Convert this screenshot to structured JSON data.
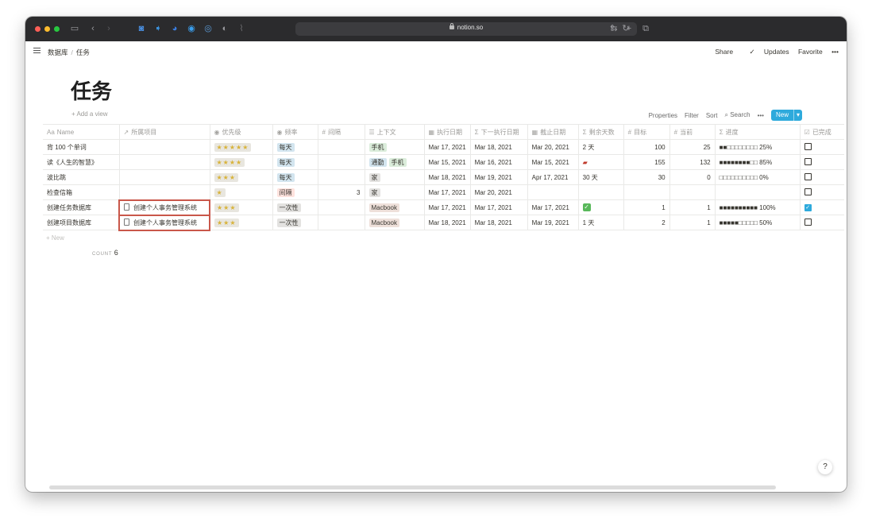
{
  "browser": {
    "url": "notion.so",
    "colors": {
      "close": "#ff5f57",
      "minimize": "#febc2e",
      "zoom": "#28c840"
    }
  },
  "topbar": {
    "breadcrumb": [
      "数据库",
      "任务"
    ],
    "share": "Share",
    "updates": "Updates",
    "favorite": "Favorite",
    "more": "•••"
  },
  "page": {
    "title": "任务",
    "add_view": "Add a view",
    "controls": {
      "properties": "Properties",
      "filter": "Filter",
      "sort": "Sort",
      "search": "Search",
      "more": "•••",
      "new": "New"
    }
  },
  "table": {
    "columns": [
      "Name",
      "所属项目",
      "优先级",
      "频率",
      "间隔",
      "上下文",
      "执行日期",
      "下一执行日期",
      "截止日期",
      "剩余天数",
      "目标",
      "当前",
      "进度",
      "已完成"
    ],
    "rows": [
      {
        "name": "背 100 个单词",
        "project": "",
        "priority": "★★★★★",
        "frequency": "每天",
        "interval": "",
        "context": [
          "手机"
        ],
        "exec_date": "Mar 17, 2021",
        "next_date": "Mar 18, 2021",
        "due_date": "Mar 20, 2021",
        "remaining": "2 天",
        "target": "100",
        "current": "25",
        "progress": "■■□□□□□□□□ 25%",
        "done": false
      },
      {
        "name": "读《人生的智慧》",
        "project": "",
        "priority": "★★★★",
        "frequency": "每天",
        "interval": "",
        "context": [
          "通勤",
          "手机"
        ],
        "exec_date": "Mar 15, 2021",
        "next_date": "Mar 16, 2021",
        "due_date": "Mar 15, 2021",
        "remaining": "",
        "target": "155",
        "current": "132",
        "progress": "■■■■■■■■□□ 85%",
        "done": false
      },
      {
        "name": "波比跳",
        "project": "",
        "priority": "★★★",
        "frequency": "每天",
        "interval": "",
        "context": [
          "家"
        ],
        "exec_date": "Mar 18, 2021",
        "next_date": "Mar 19, 2021",
        "due_date": "Apr 17, 2021",
        "remaining": "30 天",
        "target": "30",
        "current": "0",
        "progress": "□□□□□□□□□□ 0%",
        "done": false
      },
      {
        "name": "检查信箱",
        "project": "",
        "priority": "★",
        "frequency": "间隔",
        "interval": "3",
        "context": [
          "家"
        ],
        "exec_date": "Mar 17, 2021",
        "next_date": "Mar 20, 2021",
        "due_date": "",
        "remaining": "",
        "target": "",
        "current": "",
        "progress": "",
        "done": false
      },
      {
        "name": "创建任务数据库",
        "project": "创建个人事务管理系统",
        "priority": "★★★",
        "frequency": "一次性",
        "interval": "",
        "context": [
          "Macbook"
        ],
        "exec_date": "Mar 17, 2021",
        "next_date": "Mar 17, 2021",
        "due_date": "Mar 17, 2021",
        "remaining": "✓",
        "target": "1",
        "current": "1",
        "progress": "■■■■■■■■■■ 100%",
        "done": true
      },
      {
        "name": "创建项目数据库",
        "project": "创建个人事务管理系统",
        "priority": "★★★",
        "frequency": "一次性",
        "interval": "",
        "context": [
          "Macbook"
        ],
        "exec_date": "Mar 18, 2021",
        "next_date": "Mar 18, 2021",
        "due_date": "Mar 19, 2021",
        "remaining": "1 天",
        "target": "2",
        "current": "1",
        "progress": "■■■■■□□□□□ 50%",
        "done": false
      }
    ],
    "new_row": "New",
    "count_label": "COUNT",
    "count_value": "6"
  },
  "help": "?"
}
